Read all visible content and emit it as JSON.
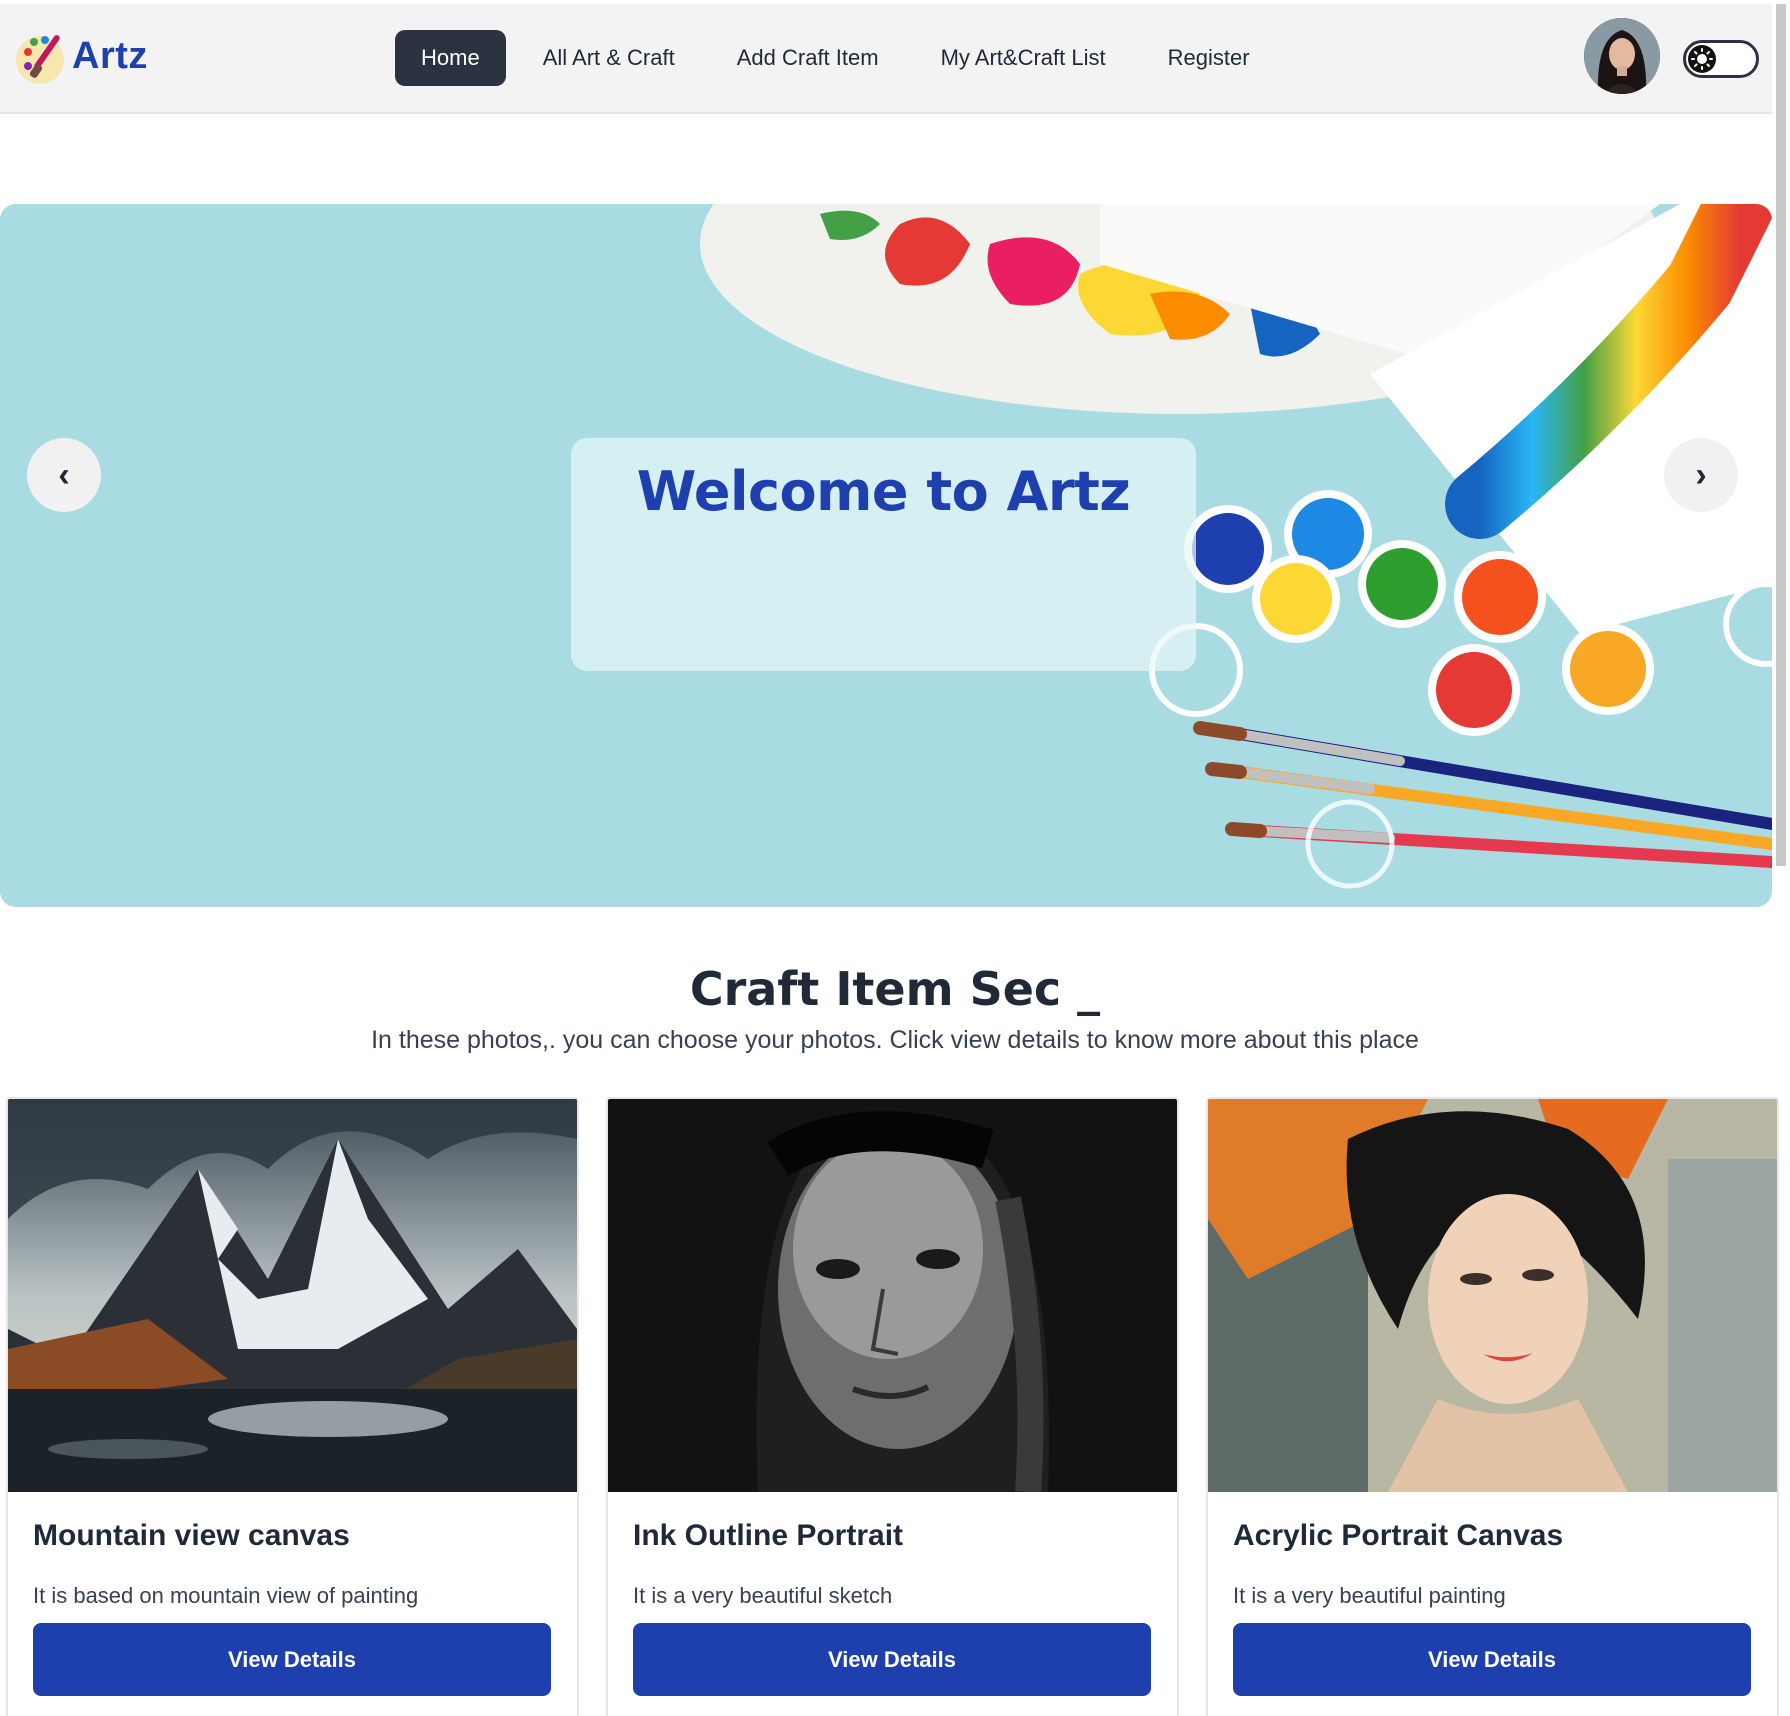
{
  "brand": {
    "name": "Artz",
    "logo_icon": "palette-icon"
  },
  "nav": {
    "items": [
      {
        "label": "Home",
        "active": true
      },
      {
        "label": "All Art & Craft",
        "active": false
      },
      {
        "label": "Add Craft Item",
        "active": false
      },
      {
        "label": "My Art&Craft List",
        "active": false
      },
      {
        "label": "Register",
        "active": false
      }
    ]
  },
  "user": {
    "avatar_icon": "user-avatar",
    "theme_toggle_icon": "sun-icon"
  },
  "hero": {
    "title": "Welcome to Artz",
    "prev_icon": "‹",
    "next_icon": "›"
  },
  "section": {
    "title": "Craft Item Sec _",
    "subtitle": "In these photos,. you can choose your photos. Click view details to know more about this place"
  },
  "cards": [
    {
      "title": "Mountain view canvas",
      "description": "It is based on mountain view of painting",
      "button": "View Details",
      "image": "mountain-landscape-painting"
    },
    {
      "title": "Ink Outline Portrait",
      "description": "It is a very beautiful sketch",
      "button": "View Details",
      "image": "black-white-portrait"
    },
    {
      "title": "Acrylic Portrait Canvas",
      "description": "It is a very beautiful painting",
      "button": "View Details",
      "image": "acrylic-woman-portrait"
    }
  ],
  "colors": {
    "accent": "#1e40af",
    "button": "#1e3fae",
    "nav_active": "#2b3240",
    "hero_bg": "#a8dbe2"
  }
}
